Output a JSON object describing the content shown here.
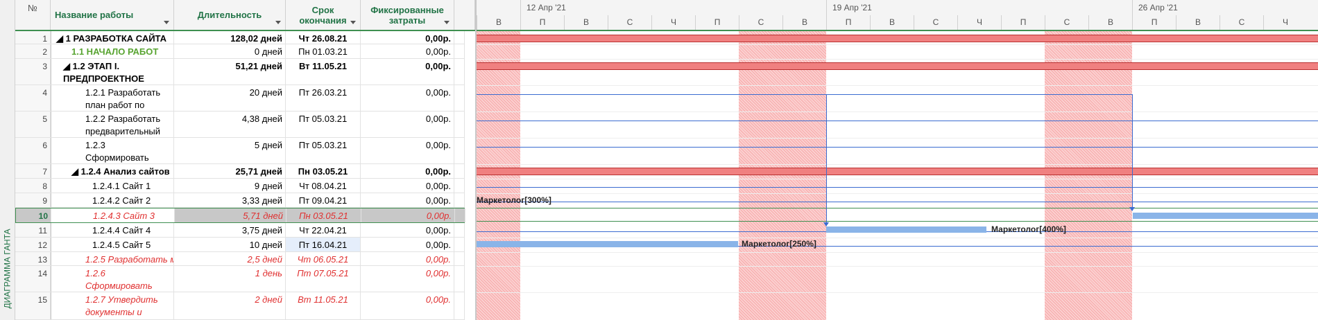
{
  "side_label": "ДИАГРАММА ГАНТА",
  "columns": {
    "num": "№",
    "name": "Название работы",
    "duration": "Длительность",
    "end": "Срок окончания",
    "cost": "Фиксированные затраты"
  },
  "rows": [
    {
      "num": "1",
      "name": "◢ 1 РАЗРАБОТКА САЙТА",
      "duration": "128,02 дней",
      "end": "Чт 26.08.21",
      "cost": "0,00р."
    },
    {
      "num": "2",
      "name": "1.1 НАЧАЛО РАБОТ",
      "duration": "0 дней",
      "end": "Пн 01.03.21",
      "cost": "0,00р."
    },
    {
      "num": "3",
      "name": "◢ 1.2 ЭТАП I. ПРЕДПРОЕКТНОЕ",
      "duration": "51,21 дней",
      "end": "Вт 11.05.21",
      "cost": "0,00р."
    },
    {
      "num": "4",
      "name": "1.2.1 Разработать план работ по",
      "duration": "20 дней",
      "end": "Пт 26.03.21",
      "cost": "0,00р."
    },
    {
      "num": "5",
      "name": "1.2.2 Разработать предварительный",
      "duration": "4,38 дней",
      "end": "Пт 05.03.21",
      "cost": "0,00р."
    },
    {
      "num": "6",
      "name": "1.2.3 Сформировать",
      "duration": "5 дней",
      "end": "Пт 05.03.21",
      "cost": "0,00р."
    },
    {
      "num": "7",
      "name": "◢ 1.2.4 Анализ сайтов",
      "duration": "25,71 дней",
      "end": "Пн 03.05.21",
      "cost": "0,00р."
    },
    {
      "num": "8",
      "name": "1.2.4.1 Сайт 1",
      "duration": "9 дней",
      "end": "Чт 08.04.21",
      "cost": "0,00р."
    },
    {
      "num": "9",
      "name": "1.2.4.2 Сайт 2",
      "duration": "3,33 дней",
      "end": "Пт 09.04.21",
      "cost": "0,00р."
    },
    {
      "num": "10",
      "name": "1.2.4.3 Сайт 3",
      "duration": "5,71 дней",
      "end": "Пн 03.05.21",
      "cost": "0,00р."
    },
    {
      "num": "11",
      "name": "1.2.4.4 Сайт 4",
      "duration": "3,75 дней",
      "end": "Чт 22.04.21",
      "cost": "0,00р."
    },
    {
      "num": "12",
      "name": "1.2.4.5 Сайт 5",
      "duration": "10 дней",
      "end": "Пт 16.04.21",
      "cost": "0,00р."
    },
    {
      "num": "13",
      "name": "1.2.5 Разработать м",
      "duration": "2,5 дней",
      "end": "Чт 06.05.21",
      "cost": "0,00р."
    },
    {
      "num": "14",
      "name": "1.2.6 Сформировать",
      "duration": "1 день",
      "end": "Пт 07.05.21",
      "cost": "0,00р."
    },
    {
      "num": "15",
      "name": "1.2.7 Утвердить документы и",
      "duration": "2 дней",
      "end": "Вт 11.05.21",
      "cost": "0,00р."
    }
  ],
  "timeline": {
    "weeks": [
      "12 Апр '21",
      "19 Апр '21",
      "26 Апр '21"
    ],
    "days": [
      "В",
      "П",
      "В",
      "С",
      "Ч",
      "П",
      "С",
      "В",
      "П",
      "В",
      "С",
      "Ч",
      "П",
      "С",
      "В",
      "П",
      "В",
      "С",
      "Ч"
    ]
  },
  "resources": {
    "row9": "Маркетолог[300%]",
    "row11": "Маркетолог[400%]",
    "row12": "Маркетолог[250%]"
  },
  "colors": {
    "accent": "#217346",
    "summary": "#f08080",
    "task_bar": "#8ab4e8",
    "critical": "#e03030",
    "link": "#3a6bd0"
  }
}
